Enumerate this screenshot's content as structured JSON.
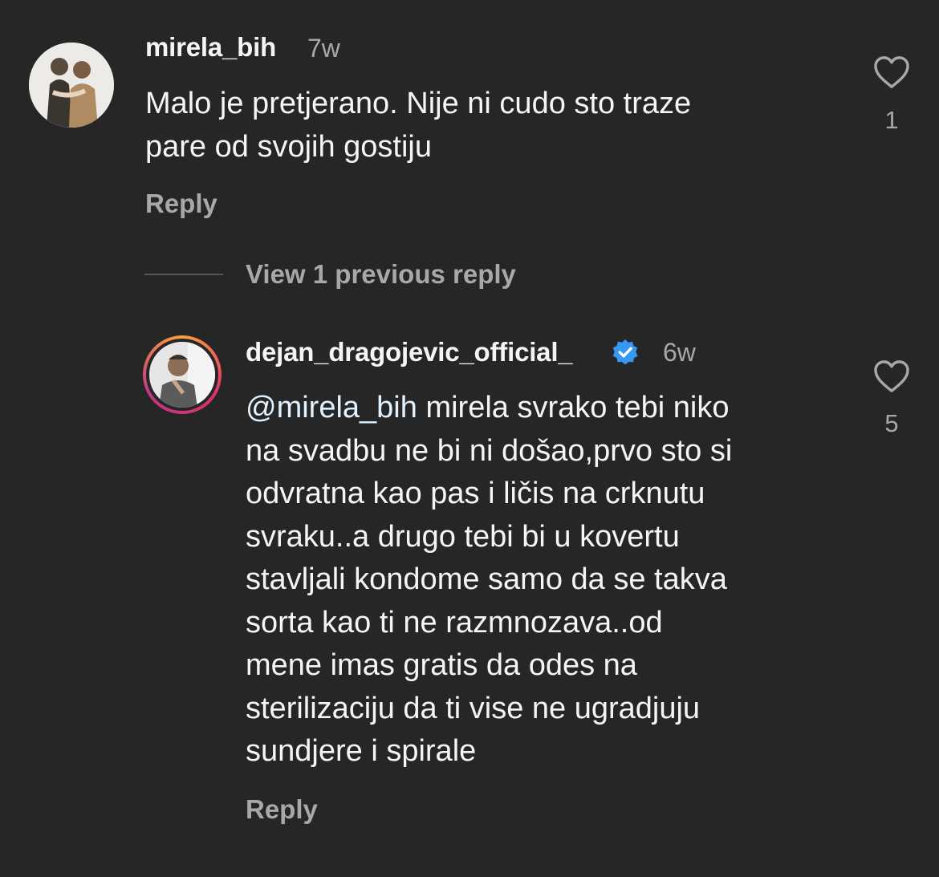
{
  "comment": {
    "username": "mirela_bih",
    "time": "7w",
    "text": "Malo je pretjerano. Nije ni cudo sto traze\npare od svojih gostiju",
    "reply_label": "Reply",
    "like_count": "1",
    "icons": {
      "avatar": "avatar-photo",
      "like": "heart-outline-icon"
    }
  },
  "replies_toggle": {
    "label": "View 1 previous reply"
  },
  "reply": {
    "username": "dejan_dragojevic_official_",
    "verified": true,
    "time": "6w",
    "mention": "@mirela_bih",
    "text": " mirela svrako tebi niko\nna svadbu ne bi ni došao,prvo sto si\nodvratna kao pas  i ličis na crknutu\nsvraku..a drugo tebi bi u kovertu\nstavljali kondome samo da se takva\nsorta kao ti ne razmnozava..od\nmene imas gratis da odes na\nsterilizaciju da ti vise ne ugradjuju\nsundjere i spirale",
    "reply_label": "Reply",
    "like_count": "5",
    "icons": {
      "avatar": "avatar-photo-story-ring",
      "verified": "verified-badge-icon",
      "like": "heart-outline-icon"
    }
  },
  "colors": {
    "background": "#262626",
    "primary_text": "#f5f5f5",
    "secondary_text": "#a8a8a8",
    "verified_blue": "#3897f0"
  }
}
